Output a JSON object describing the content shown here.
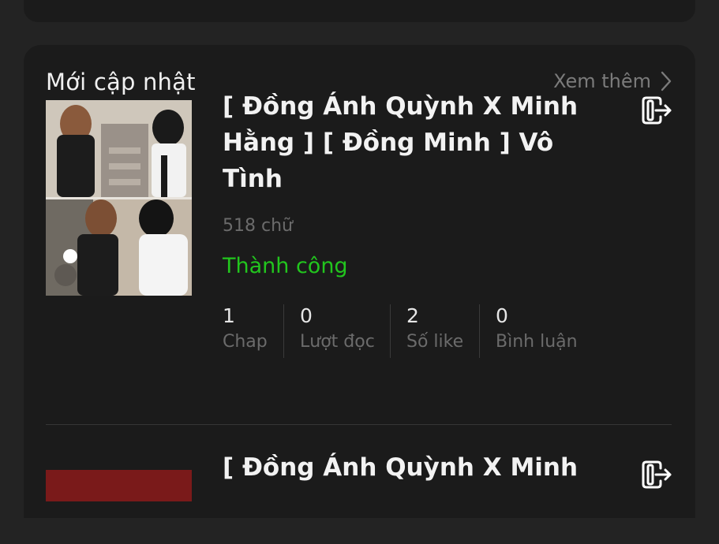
{
  "section": {
    "title": "Mới cập nhật",
    "see_more": "Xem thêm"
  },
  "stories": [
    {
      "title": "[ Đồng Ánh Quỳnh X Minh Hằng ] [ Đồng Minh ] Vô Tình",
      "word_count": "518 chữ",
      "status": "Thành công",
      "stats": [
        {
          "value": "1",
          "label": "Chap"
        },
        {
          "value": "0",
          "label": "Lượt đọc"
        },
        {
          "value": "2",
          "label": "Số like"
        },
        {
          "value": "0",
          "label": "Bình luận"
        }
      ],
      "icon": "exit-icon"
    },
    {
      "title": "[ Đồng Ánh Quỳnh X Minh",
      "icon": "exit-icon"
    }
  ],
  "colors": {
    "background": "#232323",
    "card": "#1b1b1b",
    "status_success": "#22c51e",
    "muted_text": "#6b6b6b"
  }
}
